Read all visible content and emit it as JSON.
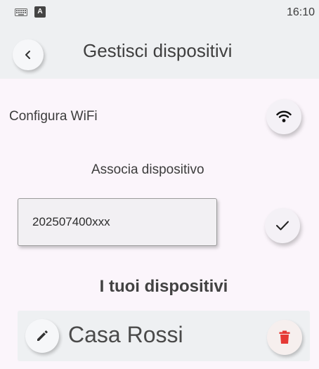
{
  "status_bar": {
    "time": "16:10",
    "icons": [
      "keyboard-icon",
      "a-notification-icon"
    ],
    "a_icon_letter": "A"
  },
  "app_bar": {
    "back_icon": "chevron-left-icon",
    "title": "Gestisci dispositivi"
  },
  "wifi": {
    "label": "Configura WiFi",
    "icon": "wifi-icon"
  },
  "associate": {
    "label": "Associa dispositivo",
    "serial_value": "202507400xxx",
    "confirm_icon": "check-icon"
  },
  "devices": {
    "title": "I tuoi dispositivi",
    "items": [
      {
        "name": "Casa Rossi",
        "edit_icon": "pencil-icon",
        "delete_icon": "trash-icon"
      }
    ]
  },
  "colors": {
    "background": "#fbf5fb",
    "bar": "#eef0f2",
    "delete_accent": "#e53935"
  }
}
